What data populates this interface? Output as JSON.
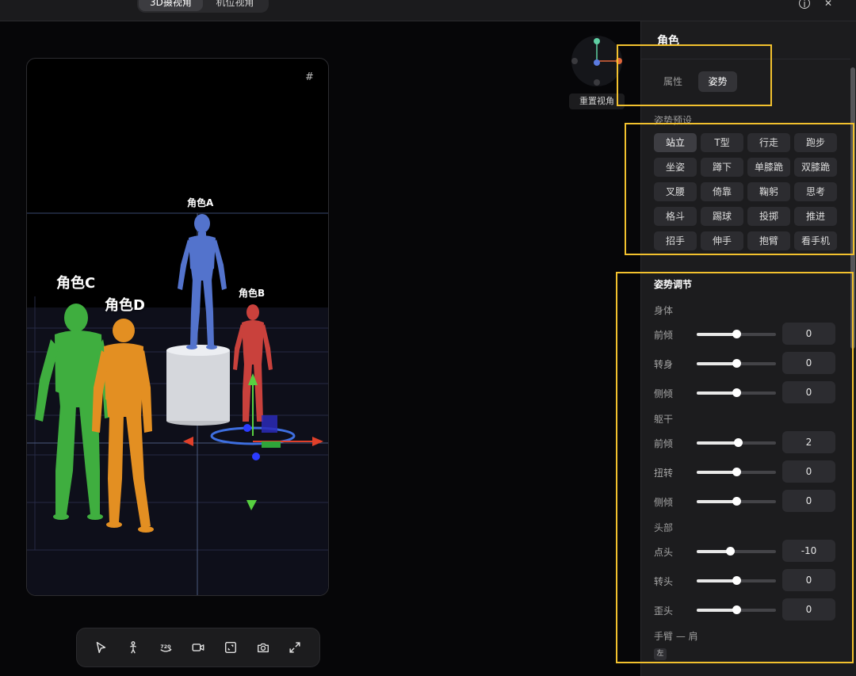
{
  "topbar": {
    "segments": [
      {
        "label": "3D摄视角",
        "active": true
      },
      {
        "label": "机位视角",
        "active": false
      }
    ],
    "info_icon": "info-icon",
    "close_icon": "close-icon"
  },
  "stage": {
    "characters": [
      {
        "name": "角色A",
        "color": "#5373cc"
      },
      {
        "name": "角色B",
        "color": "#c9413c"
      },
      {
        "name": "角色C",
        "color": "#3fae3f"
      },
      {
        "name": "角色D",
        "color": "#e38f22"
      }
    ],
    "grid_toggle_icon": "grid-icon"
  },
  "view_gizmo": {
    "reset_label": "重置视角",
    "axis_colors": {
      "x": "#e0663a",
      "y": "#5fd0a3",
      "z": "#5b7be0"
    }
  },
  "toolbar": {
    "tools": [
      {
        "name": "select-tool",
        "icon": "cursor-icon"
      },
      {
        "name": "pose-tool",
        "icon": "person-icon"
      },
      {
        "name": "rotate-tool",
        "icon": "rotate-720-icon",
        "label": "720"
      },
      {
        "name": "camera-tool",
        "icon": "video-icon"
      },
      {
        "name": "frame-tool",
        "icon": "frame-icon"
      },
      {
        "name": "screenshot-tool",
        "icon": "camera-icon"
      },
      {
        "name": "fullscreen-tool",
        "icon": "expand-icon"
      }
    ]
  },
  "panel": {
    "title": "角色",
    "tabs": [
      {
        "label": "属性",
        "active": false
      },
      {
        "label": "姿势",
        "active": true
      }
    ],
    "presets_label": "姿势预设",
    "presets": [
      {
        "label": "站立",
        "active": true
      },
      {
        "label": "T型"
      },
      {
        "label": "行走"
      },
      {
        "label": "跑步"
      },
      {
        "label": "坐姿"
      },
      {
        "label": "蹲下"
      },
      {
        "label": "单膝跪"
      },
      {
        "label": "双膝跪"
      },
      {
        "label": "叉腰"
      },
      {
        "label": "倚靠"
      },
      {
        "label": "鞠躬"
      },
      {
        "label": "思考"
      },
      {
        "label": "格斗"
      },
      {
        "label": "踢球"
      },
      {
        "label": "投掷"
      },
      {
        "label": "推进"
      },
      {
        "label": "招手"
      },
      {
        "label": "伸手"
      },
      {
        "label": "抱臂"
      },
      {
        "label": "看手机"
      }
    ],
    "adjust_title": "姿势调节",
    "groups": [
      {
        "label": "身体",
        "rows": [
          {
            "label": "前倾",
            "value": "0",
            "level": 0.5
          },
          {
            "label": "转身",
            "value": "0",
            "level": 0.5
          },
          {
            "label": "侧倾",
            "value": "0",
            "level": 0.5
          }
        ]
      },
      {
        "label": "躯干",
        "rows": [
          {
            "label": "前倾",
            "value": "2",
            "level": 0.52
          },
          {
            "label": "扭转",
            "value": "0",
            "level": 0.5
          },
          {
            "label": "侧倾",
            "value": "0",
            "level": 0.5
          }
        ]
      },
      {
        "label": "头部",
        "rows": [
          {
            "label": "点头",
            "value": "-10",
            "level": 0.42
          },
          {
            "label": "转头",
            "value": "0",
            "level": 0.5
          },
          {
            "label": "歪头",
            "value": "0",
            "level": 0.5
          }
        ]
      }
    ],
    "arm_label": "手臂 — 肩",
    "side_tag": "左"
  },
  "highlight_color": "#f2c12e"
}
